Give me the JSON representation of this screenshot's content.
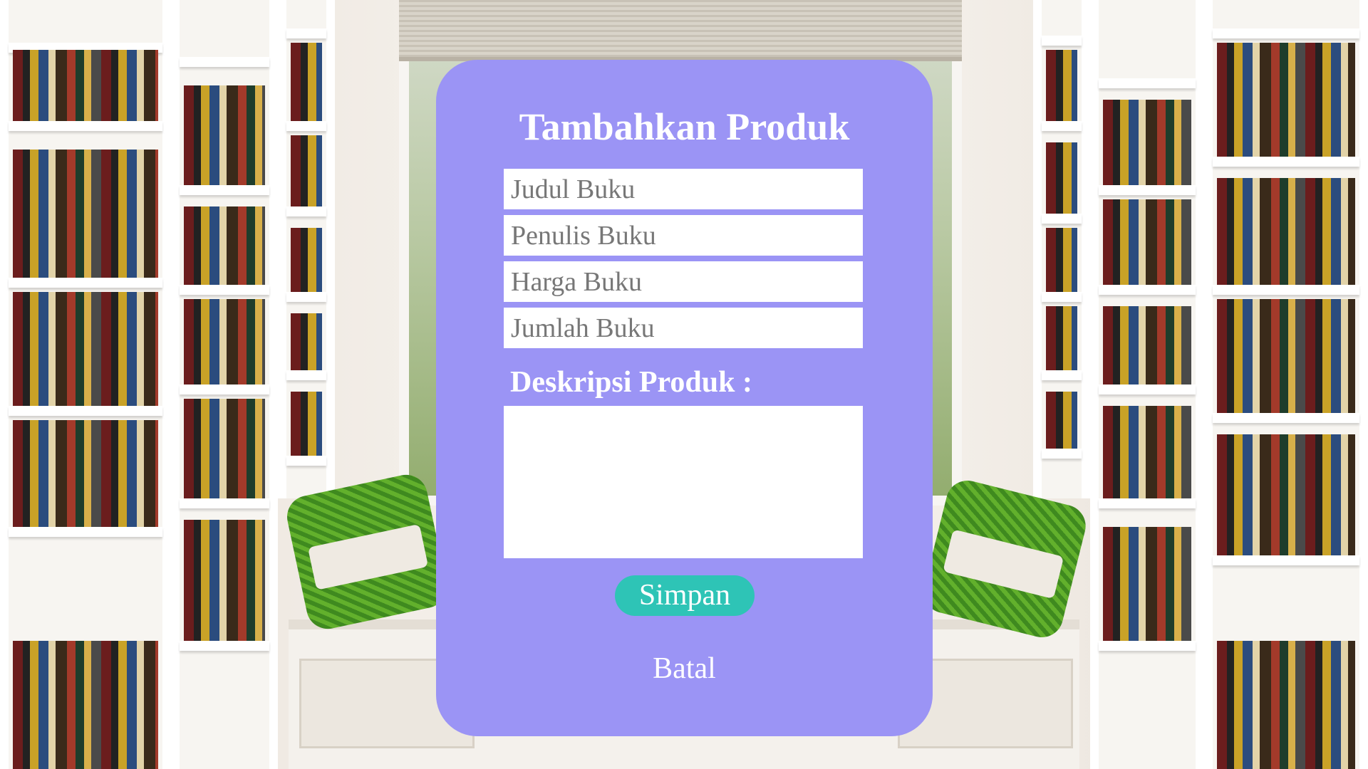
{
  "dialog": {
    "title": "Tambahkan Produk",
    "fields": {
      "judul": {
        "placeholder": "Judul Buku",
        "value": ""
      },
      "penulis": {
        "placeholder": "Penulis Buku",
        "value": ""
      },
      "harga": {
        "placeholder": "Harga Buku",
        "value": ""
      },
      "jumlah": {
        "placeholder": "Jumlah Buku",
        "value": ""
      }
    },
    "description_label": "Deskripsi Produk :",
    "description_value": "",
    "save_label": "Simpan",
    "cancel_label": "Batal"
  },
  "colors": {
    "dialog_background": "#9b94f5",
    "save_button": "#2ec4b6",
    "text_on_dialog": "#ffffff",
    "field_background": "#ffffff",
    "placeholder_text": "#777777"
  }
}
